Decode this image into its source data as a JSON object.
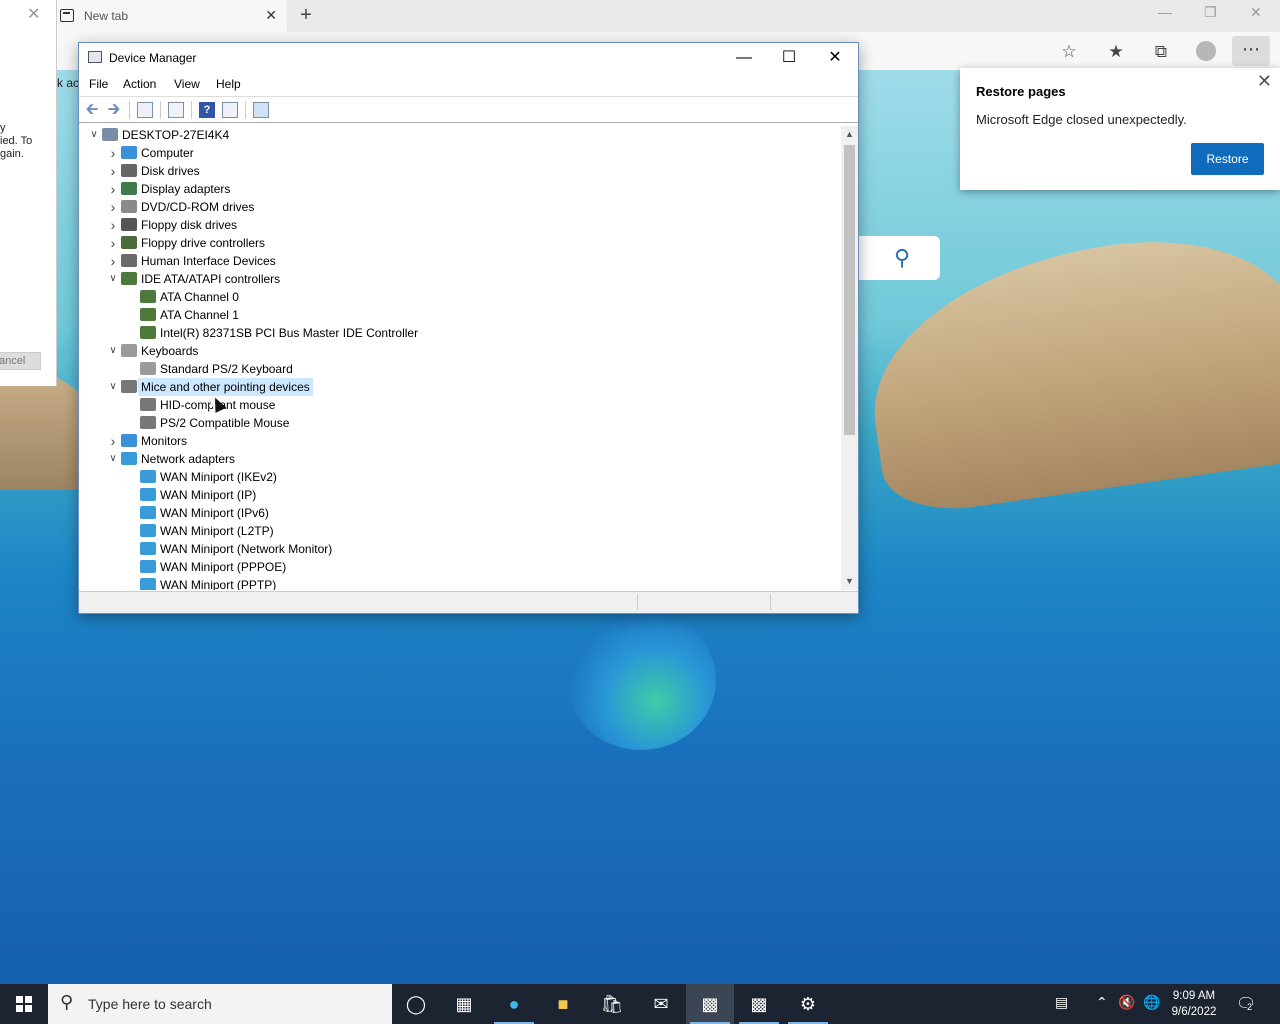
{
  "edge": {
    "tab_title": "New tab",
    "tab_close": "✕",
    "new_tab": "+",
    "more_label": "⋯",
    "restore": {
      "title": "Restore pages",
      "message": "Microsoft Edge closed unexpectedly.",
      "button": "Restore",
      "close": "✕"
    }
  },
  "bg_dialog": {
    "text_lines": "y\nied. To\ngain.",
    "partial_text": "k ac",
    "cancel_label": "ancel",
    "close": "✕"
  },
  "device_manager": {
    "title": "Device Manager",
    "menu": [
      "File",
      "Action",
      "View",
      "Help"
    ],
    "tree": [
      {
        "level": 0,
        "expander": "v",
        "label": "DESKTOP-27EI4K4",
        "icon": "computer-root-icon",
        "color": "#7a8da6"
      },
      {
        "level": 1,
        "expander": ">",
        "label": "Computer",
        "icon": "monitor-icon",
        "color": "#3a8fd9"
      },
      {
        "level": 1,
        "expander": ">",
        "label": "Disk drives",
        "icon": "disk-drive-icon",
        "color": "#666666"
      },
      {
        "level": 1,
        "expander": ">",
        "label": "Display adapters",
        "icon": "display-adapter-icon",
        "color": "#3f7a4c"
      },
      {
        "level": 1,
        "expander": ">",
        "label": "DVD/CD-ROM drives",
        "icon": "dvd-drive-icon",
        "color": "#8a8a8a"
      },
      {
        "level": 1,
        "expander": ">",
        "label": "Floppy disk drives",
        "icon": "floppy-disk-icon",
        "color": "#555555"
      },
      {
        "level": 1,
        "expander": ">",
        "label": "Floppy drive controllers",
        "icon": "floppy-controller-icon",
        "color": "#4b6b3a"
      },
      {
        "level": 1,
        "expander": ">",
        "label": "Human Interface Devices",
        "icon": "hid-icon",
        "color": "#6a6a6a"
      },
      {
        "level": 1,
        "expander": "v",
        "label": "IDE ATA/ATAPI controllers",
        "icon": "ide-controller-icon",
        "color": "#4d7a3c"
      },
      {
        "level": 2,
        "expander": "",
        "label": "ATA Channel 0",
        "icon": "ide-channel-icon",
        "color": "#4d7a3c"
      },
      {
        "level": 2,
        "expander": "",
        "label": "ATA Channel 1",
        "icon": "ide-channel-icon",
        "color": "#4d7a3c"
      },
      {
        "level": 2,
        "expander": "",
        "label": "Intel(R) 82371SB PCI Bus Master IDE Controller",
        "icon": "ide-channel-icon",
        "color": "#4d7a3c"
      },
      {
        "level": 1,
        "expander": "v",
        "label": "Keyboards",
        "icon": "keyboard-icon",
        "color": "#9a9a9a"
      },
      {
        "level": 2,
        "expander": "",
        "label": "Standard PS/2 Keyboard",
        "icon": "keyboard-icon",
        "color": "#9a9a9a"
      },
      {
        "level": 1,
        "expander": "v",
        "label": "Mice and other pointing devices",
        "icon": "mouse-icon",
        "color": "#777777",
        "selected": true
      },
      {
        "level": 2,
        "expander": "",
        "label": "HID-compliant mouse",
        "icon": "mouse-icon",
        "color": "#777777"
      },
      {
        "level": 2,
        "expander": "",
        "label": "PS/2 Compatible Mouse",
        "icon": "mouse-icon",
        "color": "#777777"
      },
      {
        "level": 1,
        "expander": ">",
        "label": "Monitors",
        "icon": "monitor-icon",
        "color": "#3a8fd9"
      },
      {
        "level": 1,
        "expander": "v",
        "label": "Network adapters",
        "icon": "network-adapter-icon",
        "color": "#3a9bd9"
      },
      {
        "level": 2,
        "expander": "",
        "label": "WAN Miniport (IKEv2)",
        "icon": "network-adapter-icon",
        "color": "#3a9bd9"
      },
      {
        "level": 2,
        "expander": "",
        "label": "WAN Miniport (IP)",
        "icon": "network-adapter-icon",
        "color": "#3a9bd9"
      },
      {
        "level": 2,
        "expander": "",
        "label": "WAN Miniport (IPv6)",
        "icon": "network-adapter-icon",
        "color": "#3a9bd9"
      },
      {
        "level": 2,
        "expander": "",
        "label": "WAN Miniport (L2TP)",
        "icon": "network-adapter-icon",
        "color": "#3a9bd9"
      },
      {
        "level": 2,
        "expander": "",
        "label": "WAN Miniport (Network Monitor)",
        "icon": "network-adapter-icon",
        "color": "#3a9bd9"
      },
      {
        "level": 2,
        "expander": "",
        "label": "WAN Miniport (PPPOE)",
        "icon": "network-adapter-icon",
        "color": "#3a9bd9"
      },
      {
        "level": 2,
        "expander": "",
        "label": "WAN Miniport (PPTP)",
        "icon": "network-adapter-icon",
        "color": "#3a9bd9"
      }
    ]
  },
  "taskbar": {
    "search_placeholder": "Type here to search",
    "time": "9:09 AM",
    "date": "9/6/2022",
    "notification_count": "2"
  }
}
